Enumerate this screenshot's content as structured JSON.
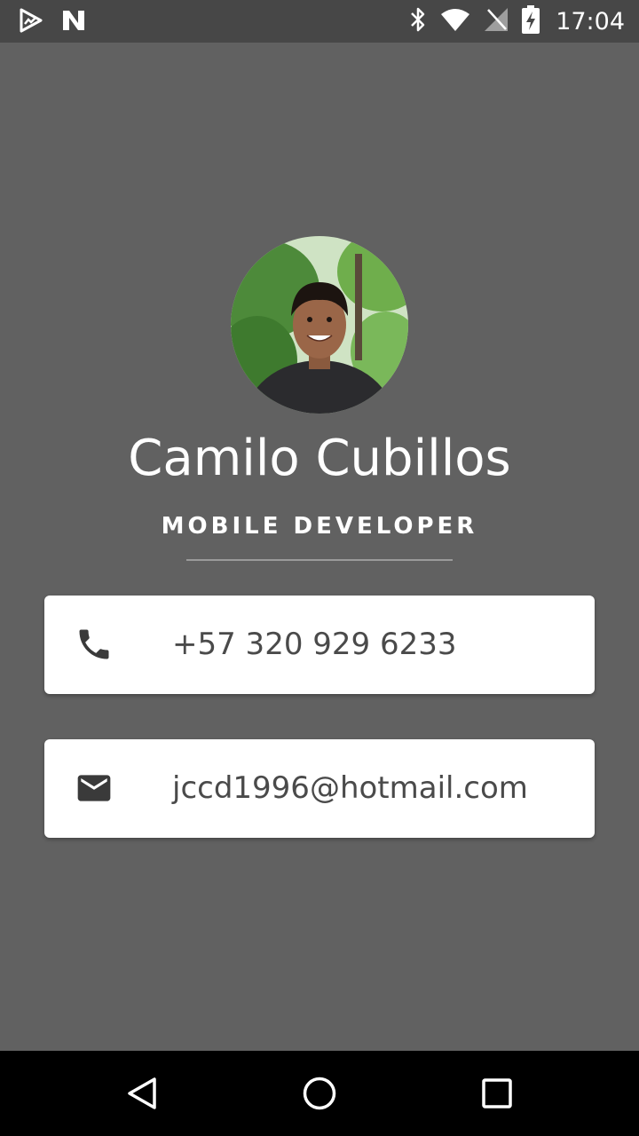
{
  "status_bar": {
    "time": "17:04",
    "left_icons": [
      "play-store-icon",
      "n-app-icon"
    ],
    "right_icons": [
      "bluetooth-icon",
      "wifi-icon",
      "no-signal-icon",
      "battery-charging-icon"
    ]
  },
  "profile": {
    "name": "Camilo Cubillos",
    "title": "MOBILE DEVELOPER"
  },
  "contacts": {
    "phone": {
      "icon": "phone-icon",
      "value": "+57 320 929 6233"
    },
    "email": {
      "icon": "mail-icon",
      "value": "jccd1996@hotmail.com"
    }
  },
  "nav_bar": {
    "buttons": [
      "back-icon",
      "home-icon",
      "recents-icon"
    ]
  },
  "colors": {
    "background": "#616161",
    "status_bar": "#474747",
    "card": "#ffffff",
    "text_primary": "#ffffff",
    "card_text": "#4a4a4a",
    "icon": "#3a3a3a"
  }
}
